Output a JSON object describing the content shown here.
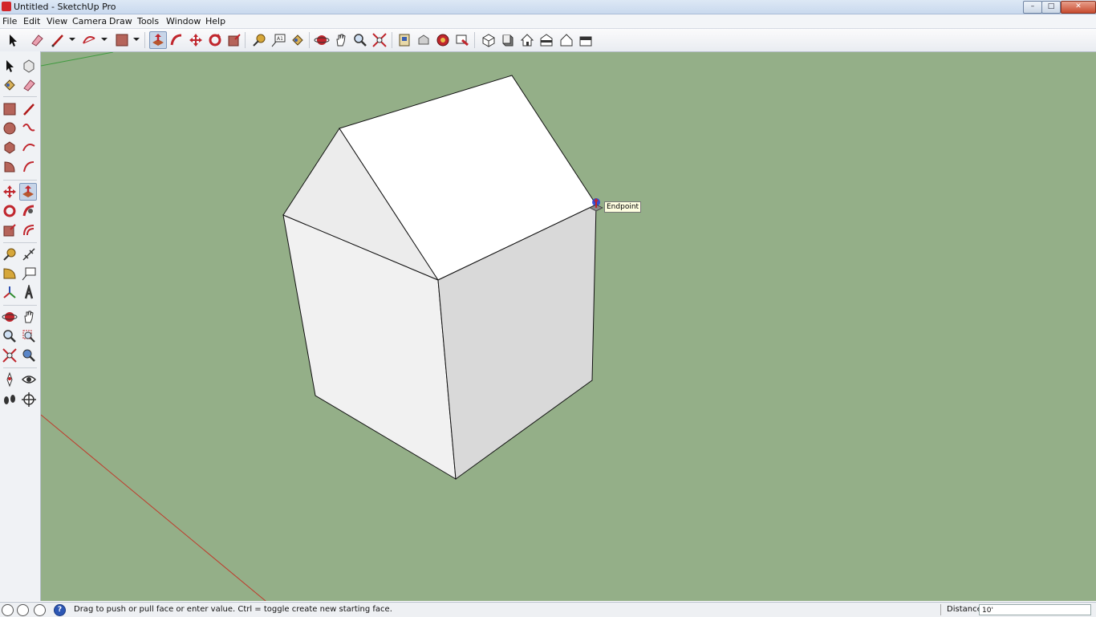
{
  "window": {
    "title": "Untitled - SketchUp Pro",
    "controls": {
      "minimize": "–",
      "maximize": "□",
      "close": "✕"
    }
  },
  "menu": [
    "File",
    "Edit",
    "View",
    "Camera",
    "Draw",
    "Tools",
    "Window",
    "Help"
  ],
  "toolbar": {
    "items": [
      "select",
      "eraser",
      "line",
      "arc",
      "rectangle",
      "push-pull",
      "follow-me",
      "move",
      "rotate",
      "scale",
      "tape-measure",
      "text",
      "paint-bucket",
      "orbit",
      "pan",
      "zoom",
      "zoom-extents",
      "warehouse",
      "extension-warehouse",
      "layout",
      "style",
      "iso-view",
      "top-view",
      "front-view",
      "right-view",
      "back-view",
      "left-view"
    ],
    "active": "push-pull"
  },
  "tool_palette": {
    "active": "push-pull"
  },
  "viewport": {
    "background_color": "#94af88",
    "inference_tooltip": "Endpoint",
    "axes": {
      "red": "#c0392b",
      "green": "#3f9a3f"
    }
  },
  "statusbar": {
    "icons": [
      "geolocation-icon",
      "credits-icon",
      "user-icon",
      "help-icon"
    ],
    "help_glyph": "?",
    "text": "Drag to push or pull face or enter value.  Ctrl = toggle create new starting face.",
    "vcb_label": "Distance",
    "vcb_value": "10'"
  }
}
